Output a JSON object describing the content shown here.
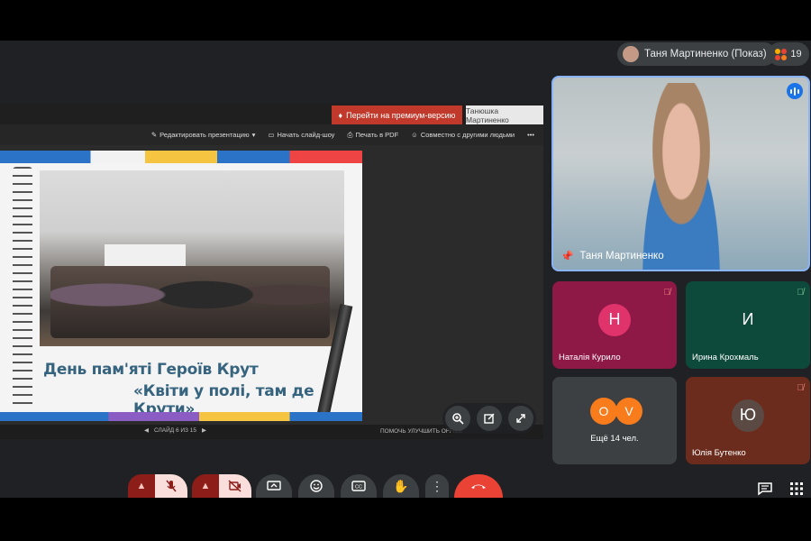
{
  "header": {
    "presenter_chip_label": "Таня Мартиненко (Показ)",
    "participant_count": "19"
  },
  "presentation": {
    "premium_button": "Перейти на премиум-версию",
    "user_tab": "Танюшка Мартиненко",
    "toolbar": {
      "edit": "Редактировать презентацию",
      "slideshow": "Начать слайд-шоу",
      "print_pdf": "Печать в PDF",
      "share": "Совместно с другими людьми"
    },
    "slide": {
      "title_line1": "День пам'яті Героїв Крут",
      "title_line2": "«Квіти у полі, там де Крути»"
    },
    "bottom": {
      "slide_counter": "СЛАЙД 6 ИЗ 15",
      "help_office": "ПОМОЧЬ УЛУЧШИТЬ OFFICE"
    }
  },
  "main_video": {
    "name": "Таня Мартиненко"
  },
  "tiles": [
    {
      "letter": "Н",
      "name": "Наталія Курило",
      "bg": "#8e1846",
      "avatar": "#e0336b",
      "muted": true
    },
    {
      "letter": "И",
      "name": "Ирина Крохмаль",
      "bg": "#0e4a3b",
      "avatar": "#0e4a3b",
      "muted": true
    },
    {
      "letter": "Ю",
      "name": "Юлія Бутенко",
      "bg": "#6b2c1e",
      "avatar": "#5b4a44",
      "muted": true
    }
  ],
  "more_tile": {
    "avatar1": "О",
    "avatar2": "V",
    "label": "Ещё 14 чел."
  },
  "colors": {
    "accent": "#8ab4f8",
    "end_call": "#ea4335",
    "premium": "#c0392b"
  }
}
